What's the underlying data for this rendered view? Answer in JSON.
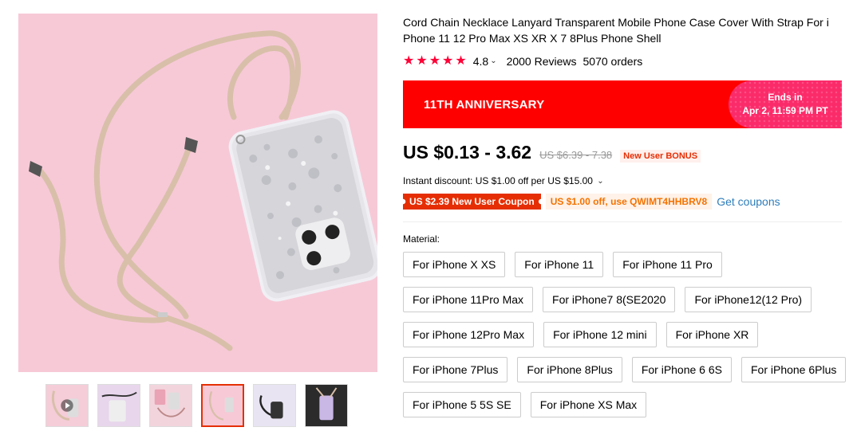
{
  "product": {
    "title": "Cord Chain Necklace Lanyard Transparent Mobile Phone Case Cover With Strap For iPhone 11 12 Pro Max XS XR X 7 8Plus Phone Shell",
    "title_line1": "Cord Chain Necklace Lanyard Transparent Mobile Phone Case Cover With Strap For i",
    "title_line2": "Phone 11 12 Pro Max XS XR X 7 8Plus Phone Shell",
    "rating": "4.8",
    "stars": 5,
    "reviews": "2000 Reviews",
    "orders": "5070 orders"
  },
  "banner": {
    "title": "11TH ANNIVERSARY",
    "ends_label": "Ends in",
    "ends_date": "Apr 2, 11:59 PM PT",
    "color": "#ff0000",
    "accent": "#fb2b6a"
  },
  "price": {
    "current": "US $0.13 - 3.62",
    "original": "US $6.39 - 7.38",
    "bonus": "New User BONUS"
  },
  "discount": {
    "text": "Instant discount: US $1.00 off per US $15.00"
  },
  "coupons": {
    "new_user": "US $2.39 New User Coupon",
    "code": "US $1.00 off, use QWIMT4HHBRV8",
    "get_label": "Get coupons"
  },
  "material": {
    "label": "Material:",
    "options": [
      "For iPhone X XS",
      "For iPhone 11",
      "For iPhone 11 Pro",
      "For iPhone 11Pro Max",
      "For iPhone7 8(SE2020",
      "For iPhone12(12 Pro)",
      "For iPhone 12Pro Max",
      "For iPhone 12 mini",
      "For iPhone XR",
      "For iPhone 7Plus",
      "For iPhone 8Plus",
      "For iPhone 6 6S",
      "For iPhone 6Plus",
      "For iPhone 5 5S SE",
      "For iPhone XS Max"
    ]
  },
  "gallery": {
    "main_icon": "phone-case-with-lanyard-image",
    "thumbnails": [
      "thumb-video",
      "thumb-2",
      "thumb-3",
      "thumb-4",
      "thumb-5",
      "thumb-6"
    ],
    "active_thumbnail": 3
  }
}
